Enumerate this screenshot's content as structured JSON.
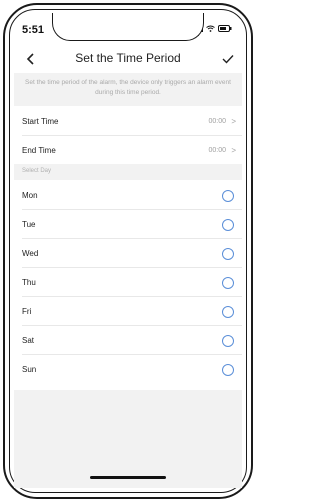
{
  "status_bar": {
    "time": "5:51"
  },
  "nav": {
    "title": "Set the Time Period"
  },
  "description": "Set the time period of the alarm, the device only triggers an alarm event during this time period.",
  "start_time": {
    "label": "Start Time",
    "value": "00:00"
  },
  "end_time": {
    "label": "End Time",
    "value": "00:00"
  },
  "select_day_header": "Select Day",
  "days": [
    {
      "label": "Mon"
    },
    {
      "label": "Tue"
    },
    {
      "label": "Wed"
    },
    {
      "label": "Thu"
    },
    {
      "label": "Fri"
    },
    {
      "label": "Sat"
    },
    {
      "label": "Sun"
    }
  ],
  "colors": {
    "accent": "#5b8fd8",
    "background_gray": "#f2f2f2"
  },
  "icons": {
    "back": "chevron-left-icon",
    "confirm": "check-icon",
    "row_arrow": "chevron-right-icon"
  }
}
